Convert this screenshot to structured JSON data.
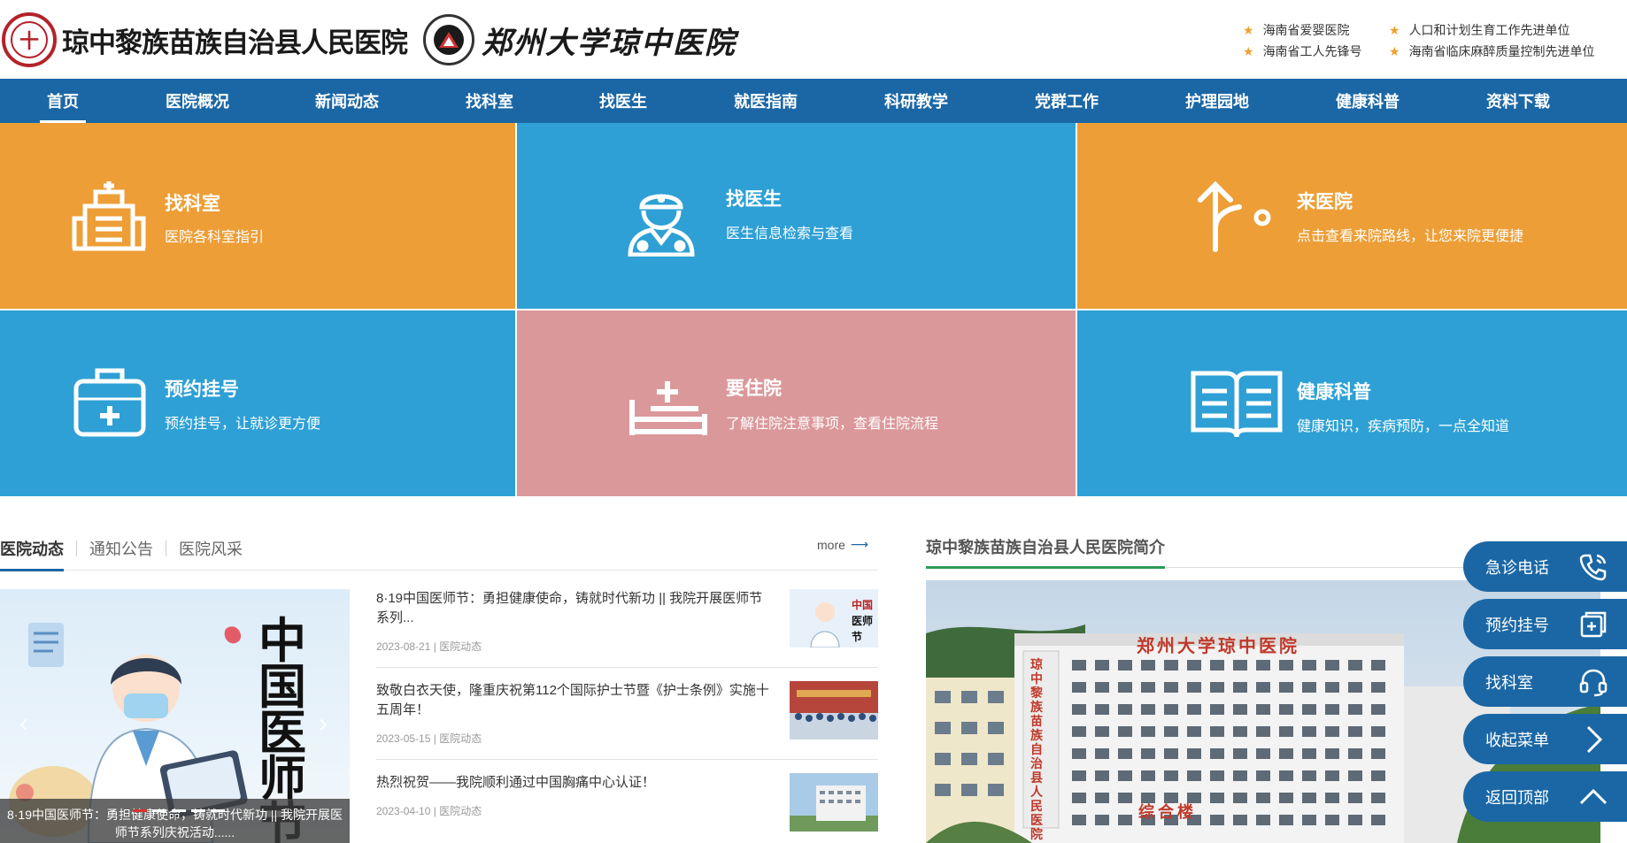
{
  "header": {
    "hospital_name": "琼中黎族苗族自治县人民医院",
    "seal_char": "十",
    "university_name": "郑州大学琼中医院",
    "honors": [
      "海南省爱婴医院",
      "人口和计划生育工作先进单位",
      "海南省工人先锋号",
      "海南省临床麻醉质量控制先进单位"
    ]
  },
  "nav": {
    "items": [
      "首页",
      "医院概况",
      "新闻动态",
      "找科室",
      "找医生",
      "就医指南",
      "科研教学",
      "党群工作",
      "护理园地",
      "健康科普",
      "资料下载"
    ],
    "active": "首页"
  },
  "tiles": [
    {
      "title": "找科室",
      "desc": "医院各科室指引",
      "color": "#ed9e36",
      "icon": "building-icon"
    },
    {
      "title": "找医生",
      "desc": "医生信息检索与查看",
      "color": "#2ea0d5",
      "icon": "doctor-icon"
    },
    {
      "title": "来医院",
      "desc": "点击查看来院路线，让您来院更便捷",
      "color": "#ed9e36",
      "icon": "route-icon"
    },
    {
      "title": "预约挂号",
      "desc": "预约挂号，让就诊更方便",
      "color": "#2ea0d5",
      "icon": "medical-kit-icon"
    },
    {
      "title": "要住院",
      "desc": "了解住院注意事项，查看住院流程",
      "color": "#db989b",
      "icon": "hospital-bed-icon"
    },
    {
      "title": "健康科普",
      "desc": "健康知识，疾病预防，一点全知道",
      "color": "#2ea0d5",
      "icon": "open-book-icon"
    }
  ],
  "news": {
    "tabs": [
      "医院动态",
      "通知公告",
      "医院风采"
    ],
    "active_tab": "医院动态",
    "more_label": "more",
    "feature": {
      "caption": "8·19中国医师节：勇担健康使命，铸就时代新功 || 我院开展医师节系列庆祝活动......",
      "poster_text": "中国医师节",
      "slide_count": 5,
      "active_slide": 0
    },
    "items": [
      {
        "title": "8·19中国医师节：勇担健康使命，铸就时代新功 || 我院开展医师节系列...",
        "date": "2023-08-21",
        "category": "医院动态",
        "thumb": "doctor-day-thumb"
      },
      {
        "title": "致敬白衣天使，隆重庆祝第112个国际护士节暨《护士条例》实施十五周年！",
        "date": "2023-05-15",
        "category": "医院动态",
        "thumb": "nurses-day-thumb"
      },
      {
        "title": "热烈祝贺——我院顺利通过中国胸痛中心认证！",
        "date": "2023-04-10",
        "category": "医院动态",
        "thumb": "building-thumb"
      }
    ]
  },
  "intro": {
    "title": "琼中黎族苗族自治县人民医院简介",
    "roof_sign": "郑州大学琼中医院",
    "vertical_sign": "琼中黎族苗族自治县人民医院",
    "building_sign": "综合楼"
  },
  "float_menu": [
    {
      "label": "急诊电话",
      "icon": "phone-icon"
    },
    {
      "label": "预约挂号",
      "icon": "register-icon"
    },
    {
      "label": "找科室",
      "icon": "headset-icon"
    },
    {
      "label": "收起菜单",
      "icon": "chevron-right-icon"
    },
    {
      "label": "返回顶部",
      "icon": "chevron-up-icon"
    }
  ]
}
